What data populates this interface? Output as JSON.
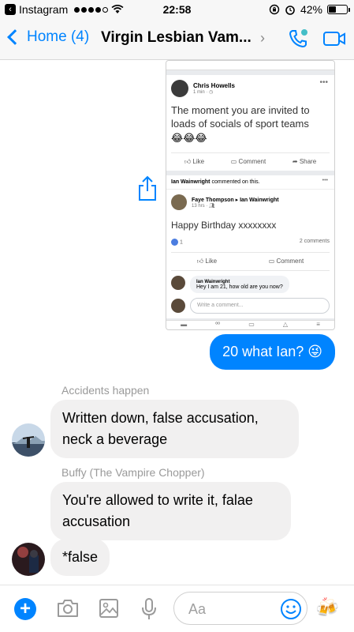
{
  "status_bar": {
    "carrier": "Instagram",
    "time": "22:58",
    "battery": "42%",
    "battery_level": 0.42
  },
  "nav": {
    "back_label": "Home (4)",
    "title": "Virgin Lesbian Vam..."
  },
  "shared_card": {
    "post1": {
      "author": "Chris Howells",
      "meta": "1 min · ",
      "text": "The moment you are invited to loads of socials of sport teams",
      "emojis": "😂😂😂",
      "like": "Like",
      "comment": "Comment",
      "share": "Share"
    },
    "activity": {
      "name": "Ian Wainwright",
      "text": " commented on this."
    },
    "post2": {
      "author": "Faye Thompson ▸ Ian Wainwright",
      "meta": "13 hrs · ",
      "text": "Happy Birthday xxxxxxxx",
      "likes": "1",
      "comments_count": "2 comments",
      "like": "Like",
      "comment": "Comment"
    },
    "reply": {
      "name": "Ian Wainwright",
      "text": "Hey I am 21, how old are you now?"
    },
    "write_placeholder": "Write a comment..."
  },
  "messages": [
    {
      "text": "20 what Ian? 😜"
    },
    {
      "sender": "Accidents happen",
      "text": "Written down, false accusation, neck a beverage"
    },
    {
      "sender": "Buffy (The Vampire Chopper)",
      "text": "You're allowed to write it, falae accusation"
    },
    {
      "text": "*false"
    }
  ],
  "composer": {
    "placeholder": "Aa",
    "plus": "+"
  },
  "colors": {
    "accent": "#0084ff",
    "incoming_bubble": "#f1f0f0",
    "call_icon": "#44bec7"
  }
}
